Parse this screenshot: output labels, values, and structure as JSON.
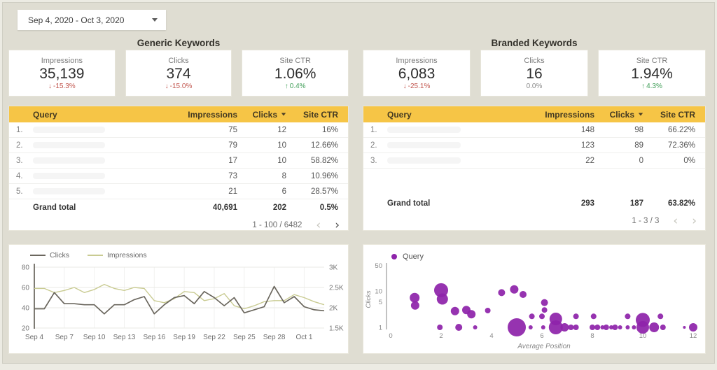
{
  "date_picker": {
    "label": "Sep 4, 2020 - Oct 3, 2020"
  },
  "colors": {
    "page_bg": "#dfddd2",
    "header_yellow": "#f6c546",
    "negative_red": "#c1544c",
    "positive_green": "#3f9e57",
    "clicks_line": "#6b675e",
    "impressions_line": "#c9cb92",
    "bubble_purple": "#8e24aa"
  },
  "generic": {
    "title": "Generic Keywords",
    "scorecards": [
      {
        "label": "Impressions",
        "value": "35,139",
        "delta": "-15.3%",
        "trend": "down"
      },
      {
        "label": "Clicks",
        "value": "374",
        "delta": "-15.0%",
        "trend": "down"
      },
      {
        "label": "Site CTR",
        "value": "1.06%",
        "delta": "0.4%",
        "trend": "up"
      }
    ],
    "table": {
      "headers": {
        "query": "Query",
        "impressions": "Impressions",
        "clicks": "Clicks",
        "ctr": "Site CTR"
      },
      "sorted_by": "Clicks",
      "sort_direction": "desc",
      "rows": [
        {
          "rank": "1.",
          "query": "",
          "impressions": "75",
          "clicks": "12",
          "ctr": "16%"
        },
        {
          "rank": "2.",
          "query": "",
          "impressions": "79",
          "clicks": "10",
          "ctr": "12.66%"
        },
        {
          "rank": "3.",
          "query": "",
          "impressions": "17",
          "clicks": "10",
          "ctr": "58.82%"
        },
        {
          "rank": "4.",
          "query": "",
          "impressions": "73",
          "clicks": "8",
          "ctr": "10.96%"
        },
        {
          "rank": "5.",
          "query": "",
          "impressions": "21",
          "clicks": "6",
          "ctr": "28.57%"
        }
      ],
      "grand_total": {
        "label": "Grand total",
        "impressions": "40,691",
        "clicks": "202",
        "ctr": "0.5%"
      },
      "pagination": {
        "text": "1 - 100 / 6482",
        "prev_enabled": false,
        "next_enabled": true
      }
    }
  },
  "branded": {
    "title": "Branded Keywords",
    "scorecards": [
      {
        "label": "Impressions",
        "value": "6,083",
        "delta": "-25.1%",
        "trend": "down"
      },
      {
        "label": "Clicks",
        "value": "16",
        "delta": "0.0%",
        "trend": "flat"
      },
      {
        "label": "Site CTR",
        "value": "1.94%",
        "delta": "4.3%",
        "trend": "up"
      }
    ],
    "table": {
      "headers": {
        "query": "Query",
        "impressions": "Impressions",
        "clicks": "Clicks",
        "ctr": "Site CTR"
      },
      "sorted_by": "Clicks",
      "sort_direction": "desc",
      "rows": [
        {
          "rank": "1.",
          "query": "",
          "impressions": "148",
          "clicks": "98",
          "ctr": "66.22%"
        },
        {
          "rank": "2.",
          "query": "",
          "impressions": "123",
          "clicks": "89",
          "ctr": "72.36%"
        },
        {
          "rank": "3.",
          "query": "",
          "impressions": "22",
          "clicks": "0",
          "ctr": "0%"
        }
      ],
      "grand_total": {
        "label": "Grand total",
        "impressions": "293",
        "clicks": "187",
        "ctr": "63.82%"
      },
      "pagination": {
        "text": "1 - 3 / 3",
        "prev_enabled": false,
        "next_enabled": false
      }
    }
  },
  "chart_data": [
    {
      "type": "line",
      "title": "Clicks and Impressions by date (Generic Keywords)",
      "x": [
        "Sep 4",
        "Sep 5",
        "Sep 6",
        "Sep 7",
        "Sep 8",
        "Sep 9",
        "Sep 10",
        "Sep 11",
        "Sep 12",
        "Sep 13",
        "Sep 14",
        "Sep 15",
        "Sep 16",
        "Sep 17",
        "Sep 18",
        "Sep 19",
        "Sep 20",
        "Sep 21",
        "Sep 22",
        "Sep 23",
        "Sep 24",
        "Sep 25",
        "Sep 26",
        "Sep 27",
        "Sep 28",
        "Sep 29",
        "Sep 30",
        "Oct 1",
        "Oct 2",
        "Oct 3"
      ],
      "x_tick_labels": [
        "Sep 4",
        "Sep 7",
        "Sep 10",
        "Sep 13",
        "Sep 16",
        "Sep 19",
        "Sep 22",
        "Sep 25",
        "Sep 28",
        "Oct 1"
      ],
      "series": [
        {
          "name": "Clicks",
          "axis": "left",
          "color": "#6b675e",
          "values": [
            39,
            39,
            55,
            44,
            44,
            43,
            43,
            34,
            43,
            43,
            48,
            51,
            34,
            43,
            50,
            52,
            44,
            56,
            50,
            42,
            50,
            35,
            38,
            41,
            61,
            45,
            51,
            41,
            38,
            37
          ]
        },
        {
          "name": "Impressions",
          "axis": "right",
          "color": "#c9cb92",
          "values": [
            2475,
            2475,
            2375,
            2425,
            2500,
            2375,
            2450,
            2575,
            2475,
            2425,
            2500,
            2475,
            2175,
            2125,
            2225,
            2400,
            2375,
            2175,
            2225,
            2350,
            2050,
            1975,
            2050,
            2150,
            2175,
            2175,
            2325,
            2250,
            2150,
            2075
          ]
        }
      ],
      "left_axis": {
        "ticks": [
          20,
          40,
          60,
          80
        ],
        "range": [
          20,
          80
        ]
      },
      "right_axis": {
        "ticks": [
          "1.5K",
          "2K",
          "2.5K",
          "3K"
        ],
        "tick_values": [
          1500,
          2000,
          2500,
          3000
        ],
        "range": [
          1500,
          3000
        ]
      },
      "legend_position": "top-left",
      "grid": true
    },
    {
      "type": "scatter",
      "title": "Queries by Average Position and Clicks",
      "legend": "Query",
      "xlabel": "Average Position",
      "ylabel": "Clicks",
      "x_ticks": [
        0,
        2,
        4,
        6,
        8,
        10,
        12
      ],
      "xlim": [
        0,
        12.5
      ],
      "y_ticks": [
        1,
        5,
        10,
        50
      ],
      "y_scale": "log",
      "color": "#8e24aa",
      "bubbles": [
        [
          0.95,
          6.5,
          7
        ],
        [
          0.97,
          4,
          6
        ],
        [
          1.95,
          1,
          4
        ],
        [
          2.0,
          10.5,
          10
        ],
        [
          2.05,
          6,
          8
        ],
        [
          2.55,
          2.8,
          6
        ],
        [
          2.7,
          1,
          5
        ],
        [
          3.0,
          3,
          6
        ],
        [
          3.2,
          2.3,
          6
        ],
        [
          3.35,
          1,
          3
        ],
        [
          3.85,
          2.9,
          4
        ],
        [
          4.4,
          9,
          5
        ],
        [
          4.9,
          11,
          6
        ],
        [
          5.25,
          8,
          5
        ],
        [
          5.0,
          1,
          13
        ],
        [
          5.55,
          1,
          3
        ],
        [
          5.6,
          2,
          4
        ],
        [
          6.0,
          2,
          4
        ],
        [
          6.05,
          1,
          3
        ],
        [
          6.1,
          4.8,
          5
        ],
        [
          6.1,
          3,
          4
        ],
        [
          6.55,
          1.7,
          9
        ],
        [
          6.55,
          1,
          10
        ],
        [
          6.9,
          1,
          6
        ],
        [
          7.15,
          1,
          4
        ],
        [
          7.35,
          2,
          4
        ],
        [
          7.35,
          1,
          4
        ],
        [
          8.05,
          2,
          4
        ],
        [
          8.0,
          1,
          4
        ],
        [
          8.2,
          1,
          4
        ],
        [
          8.4,
          1,
          3
        ],
        [
          8.55,
          1,
          4
        ],
        [
          8.75,
          1,
          3
        ],
        [
          8.9,
          1,
          4
        ],
        [
          9.1,
          1,
          3
        ],
        [
          9.4,
          2,
          4
        ],
        [
          9.4,
          1,
          3
        ],
        [
          9.65,
          1,
          3
        ],
        [
          10.0,
          1.6,
          10
        ],
        [
          10.0,
          1,
          9
        ],
        [
          10.45,
          1,
          7
        ],
        [
          10.7,
          2,
          4
        ],
        [
          10.8,
          1,
          4
        ],
        [
          11.65,
          1,
          2
        ],
        [
          12.0,
          1,
          6
        ]
      ]
    }
  ]
}
